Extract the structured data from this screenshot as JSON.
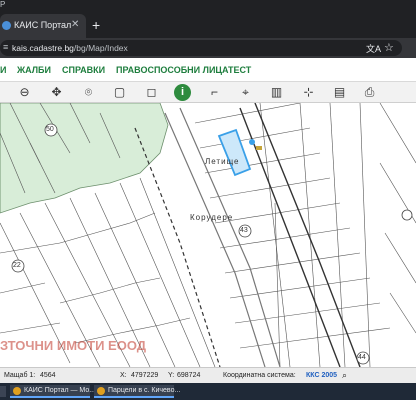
{
  "browser": {
    "top_strip_text": "P",
    "tab": {
      "label": "КАИС Портал",
      "close_symbol": "✕"
    },
    "new_tab_symbol": "+",
    "address": {
      "host": "kais.cadastre.bg",
      "path": "/bg/Map/Index"
    }
  },
  "site_nav": {
    "items": [
      "И",
      "ЖАЛБИ",
      "СПРАВКИ",
      "ПРАВОСПОСОБНИ ЛИЦА",
      "ТЕСТ"
    ]
  },
  "map": {
    "labels": {
      "street1": "Летище",
      "street2": "Корудере",
      "num_43": "43",
      "num_50": "50",
      "num_22": "22",
      "num_44": "44"
    },
    "watermark": "ЗТОЧНИ ИМОТИ ЕООД"
  },
  "status_bar": {
    "scale_label": "Мащаб 1:",
    "scale_value": "4564",
    "x_label": "X:",
    "x_value": "4797229",
    "y_label": "Y:",
    "y_value": "698724",
    "system_label": "Координатна система:",
    "system_value": "ККС 2005"
  },
  "taskbar": {
    "items": [
      "КАИС Портал — Мо...",
      "Парцели в с. Кичево..."
    ]
  },
  "colors": {
    "accent_green": "#1e7e3e",
    "selection_blue": "#3aa0e8",
    "forest_green": "#d8edd8",
    "watermark_red": "#c0392b"
  }
}
